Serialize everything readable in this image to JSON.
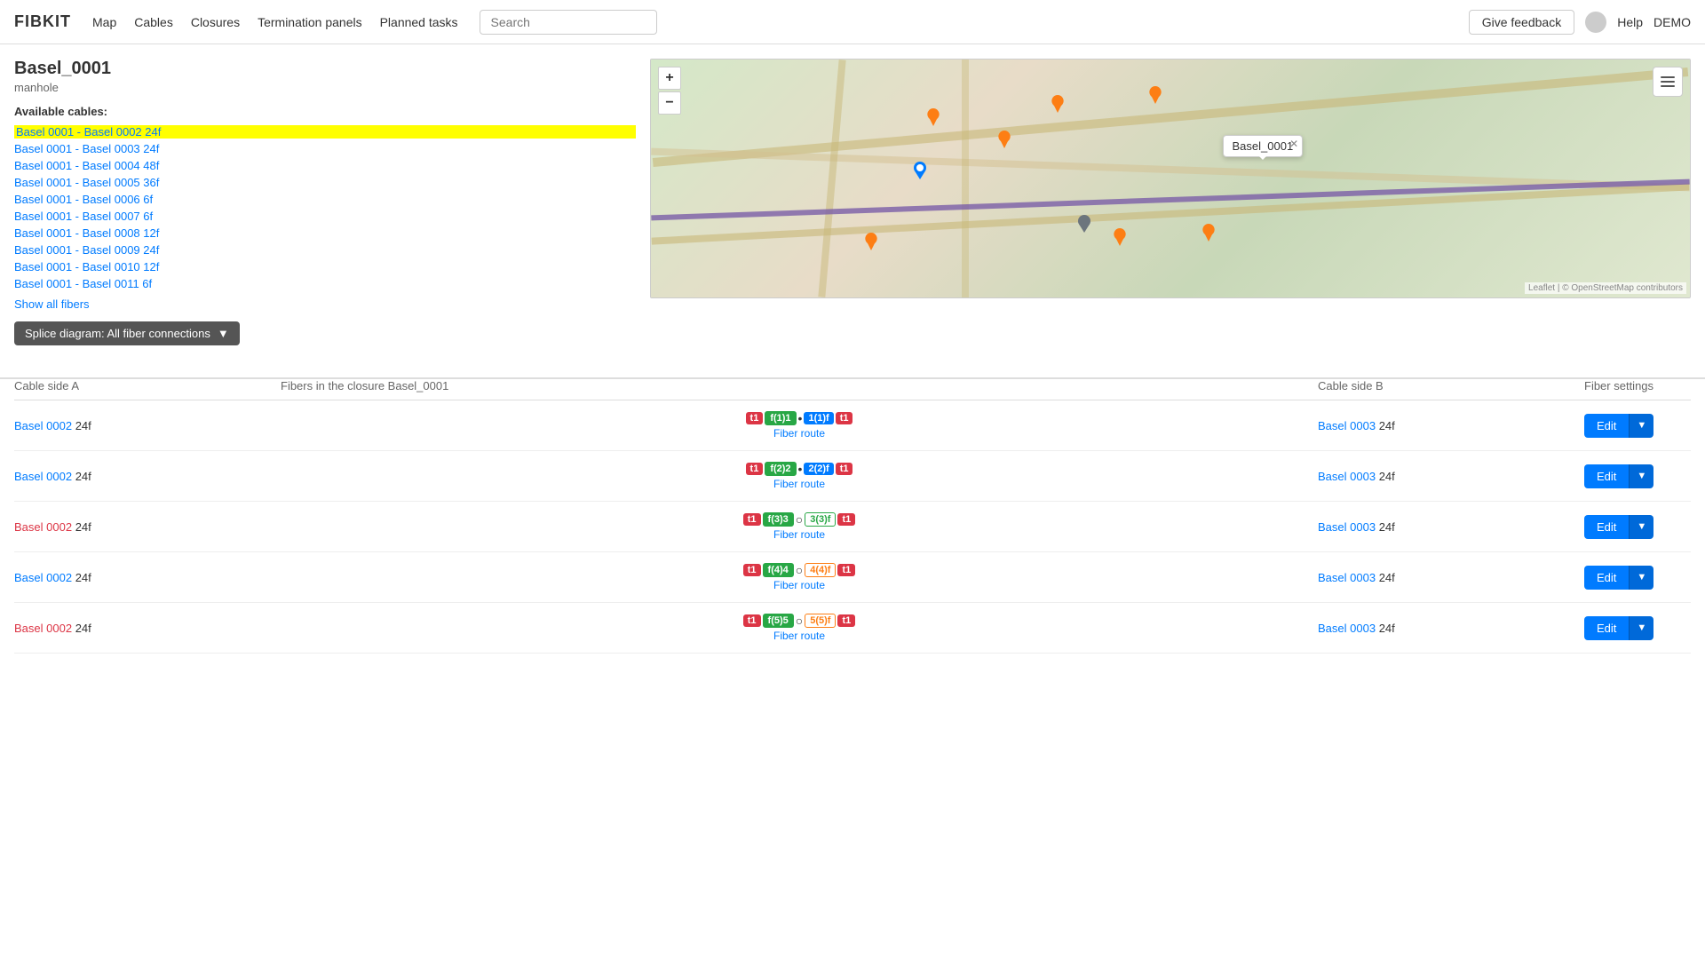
{
  "brand": "FIBKIT",
  "nav": {
    "links": [
      "Map",
      "Cables",
      "Closures",
      "Termination panels",
      "Planned tasks"
    ],
    "search_placeholder": "Search",
    "feedback_label": "Give feedback",
    "help_label": "Help",
    "demo_label": "DEMO"
  },
  "page": {
    "title": "Basel_0001",
    "subtitle": "manhole",
    "cables_label": "Available cables:"
  },
  "cables": [
    {
      "label": "Basel 0001 - Basel 0002 24f",
      "highlighted": true
    },
    {
      "label": "Basel 0001 - Basel 0003 24f",
      "highlighted": false
    },
    {
      "label": "Basel 0001 - Basel 0004 48f",
      "highlighted": false
    },
    {
      "label": "Basel 0001 - Basel 0005 36f",
      "highlighted": false
    },
    {
      "label": "Basel 0001 - Basel 0006 6f",
      "highlighted": false
    },
    {
      "label": "Basel 0001 - Basel 0007 6f",
      "highlighted": false
    },
    {
      "label": "Basel 0001 - Basel 0008 12f",
      "highlighted": false
    },
    {
      "label": "Basel 0001 - Basel 0009 24f",
      "highlighted": false
    },
    {
      "label": "Basel 0001 - Basel 0010 12f",
      "highlighted": false
    },
    {
      "label": "Basel 0001 - Basel 0011 6f",
      "highlighted": false
    }
  ],
  "show_all_label": "Show all fibers",
  "splice_label": "Splice diagram: All fiber connections",
  "map": {
    "popup_label": "Basel_0001",
    "zoom_in": "+",
    "zoom_out": "−",
    "attribution": "Leaflet | © OpenStreetMap contributors"
  },
  "table": {
    "col_a": "Cable side A",
    "col_fibers": "Fibers in the closure Basel_0001",
    "col_b": "Cable side B",
    "col_settings": "Fiber settings",
    "rows": [
      {
        "side_a_link": "Basel 0002",
        "side_a_extra": "24f",
        "side_a_red": true,
        "fiber_badge1": "t1",
        "fiber_label": "f(1)1",
        "dot": "•",
        "fiber_badge2": "1(1)f",
        "fiber_badge3": "t1",
        "fiber_route": "Fiber route",
        "side_b_link": "Basel 0003",
        "side_b_extra": "24f",
        "edit_label": "Edit"
      },
      {
        "side_a_link": "Basel 0002",
        "side_a_extra": "24f",
        "side_a_red": false,
        "fiber_badge1": "t1",
        "fiber_label": "f(2)2",
        "dot": "•",
        "fiber_badge2": "2(2)f",
        "fiber_badge3": "t1",
        "fiber_route": "Fiber route",
        "side_b_link": "Basel 0003",
        "side_b_extra": "24f",
        "edit_label": "Edit"
      },
      {
        "side_a_link": "Basel 0002",
        "side_a_extra": "24f",
        "side_a_red": true,
        "fiber_badge1": "t1",
        "fiber_label": "f(3)3",
        "dot": "○",
        "fiber_badge2": "3(3)f",
        "fiber_badge3": "t1",
        "fiber_route": "Fiber route",
        "side_b_link": "Basel 0003",
        "side_b_extra": "24f",
        "edit_label": "Edit"
      },
      {
        "side_a_link": "Basel 0002",
        "side_a_extra": "24f",
        "side_a_red": false,
        "fiber_badge1": "t1",
        "fiber_label": "f(4)4",
        "dot": "○",
        "fiber_badge2": "4(4)f",
        "fiber_badge3": "t1",
        "fiber_route": "Fiber route",
        "side_b_link": "Basel 0003",
        "side_b_extra": "24f",
        "edit_label": "Edit"
      },
      {
        "side_a_link": "Basel 0002",
        "side_a_extra": "24f",
        "side_a_red": true,
        "fiber_badge1": "t1",
        "fiber_label": "f(5)5",
        "dot": "○",
        "fiber_badge2": "5(5)f",
        "fiber_badge3": "t1",
        "fiber_route": "Fiber route",
        "side_b_link": "Basel 0003",
        "side_b_extra": "24f",
        "edit_label": "Edit"
      }
    ]
  }
}
